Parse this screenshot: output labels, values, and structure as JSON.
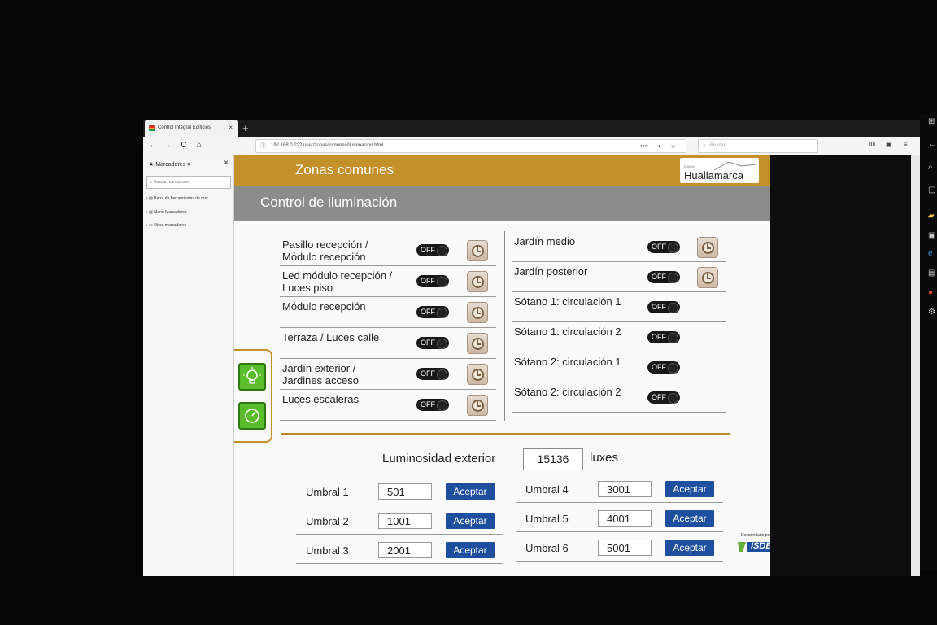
{
  "browser": {
    "tab_title": "Control Integral Edificios",
    "tab_close": "×",
    "new_tab": "+",
    "url": "192.168.0.222/user/zonascomunes/iluminacion.html",
    "search_placeholder": "Buscar",
    "nav": {
      "back": "←",
      "forward": "→",
      "reload": "C",
      "home": "⌂"
    },
    "url_icons": {
      "more": "•••",
      "pocket": "◐",
      "star": "☆"
    },
    "right_icons": {
      "library": "lll\\",
      "sidebar": "▣",
      "menu": "≡"
    }
  },
  "sidebar": {
    "title": "Marcadores",
    "close": "×",
    "search_placeholder": "Buscar marcadores",
    "items": [
      "Barra de herramientas de mar...",
      "Menú Marcadores",
      "Otros marcadores"
    ]
  },
  "header": {
    "section_title": "Zonas comunes",
    "page_title": "Control de iluminación",
    "logo_small": "Edificio",
    "logo_big": "Huallamarca"
  },
  "lights_left": [
    {
      "label": "Pasillo recepción / Módulo recepción",
      "state": "OFF"
    },
    {
      "label": "Led módulo recepción / Luces piso",
      "state": "OFF"
    },
    {
      "label": "Módulo recepción",
      "state": "OFF"
    },
    {
      "label": "Terraza / Luces calle",
      "state": "OFF"
    },
    {
      "label": "Jardín exterior / Jardines acceso",
      "state": "OFF"
    },
    {
      "label": "Luces escaleras",
      "state": "OFF"
    }
  ],
  "lights_right": [
    {
      "label": "Jardín medio",
      "state": "OFF"
    },
    {
      "label": "Jardín posterior",
      "state": "OFF"
    },
    {
      "label": "Sótano 1: circulación 1",
      "state": "OFF"
    },
    {
      "label": "Sótano 1: circulación 2",
      "state": "OFF"
    },
    {
      "label": "Sótano 2: circulación 1",
      "state": "OFF"
    },
    {
      "label": "Sótano 2: circulación 2",
      "state": "OFF"
    }
  ],
  "luminosity": {
    "label": "Luminosidad exterior",
    "value": "15136",
    "unit": "luxes"
  },
  "thresholds_left": [
    {
      "label": "Umbral 1",
      "value": "501",
      "button": "Aceptar"
    },
    {
      "label": "Umbral 2",
      "value": "1001",
      "button": "Aceptar"
    },
    {
      "label": "Umbral 3",
      "value": "2001",
      "button": "Aceptar"
    }
  ],
  "thresholds_right": [
    {
      "label": "Umbral 4",
      "value": "3001",
      "button": "Aceptar"
    },
    {
      "label": "Umbral 5",
      "value": "4001",
      "button": "Aceptar"
    },
    {
      "label": "Umbral 6",
      "value": "5001",
      "button": "Aceptar"
    }
  ],
  "footer": {
    "developed_by": "Desarrollado por",
    "brand": "ISDE"
  },
  "colors": {
    "gold": "#c4902a",
    "grey_band": "#8c8c8c",
    "accept_blue": "#1d4f9e",
    "green_button": "#5bbd2b"
  }
}
